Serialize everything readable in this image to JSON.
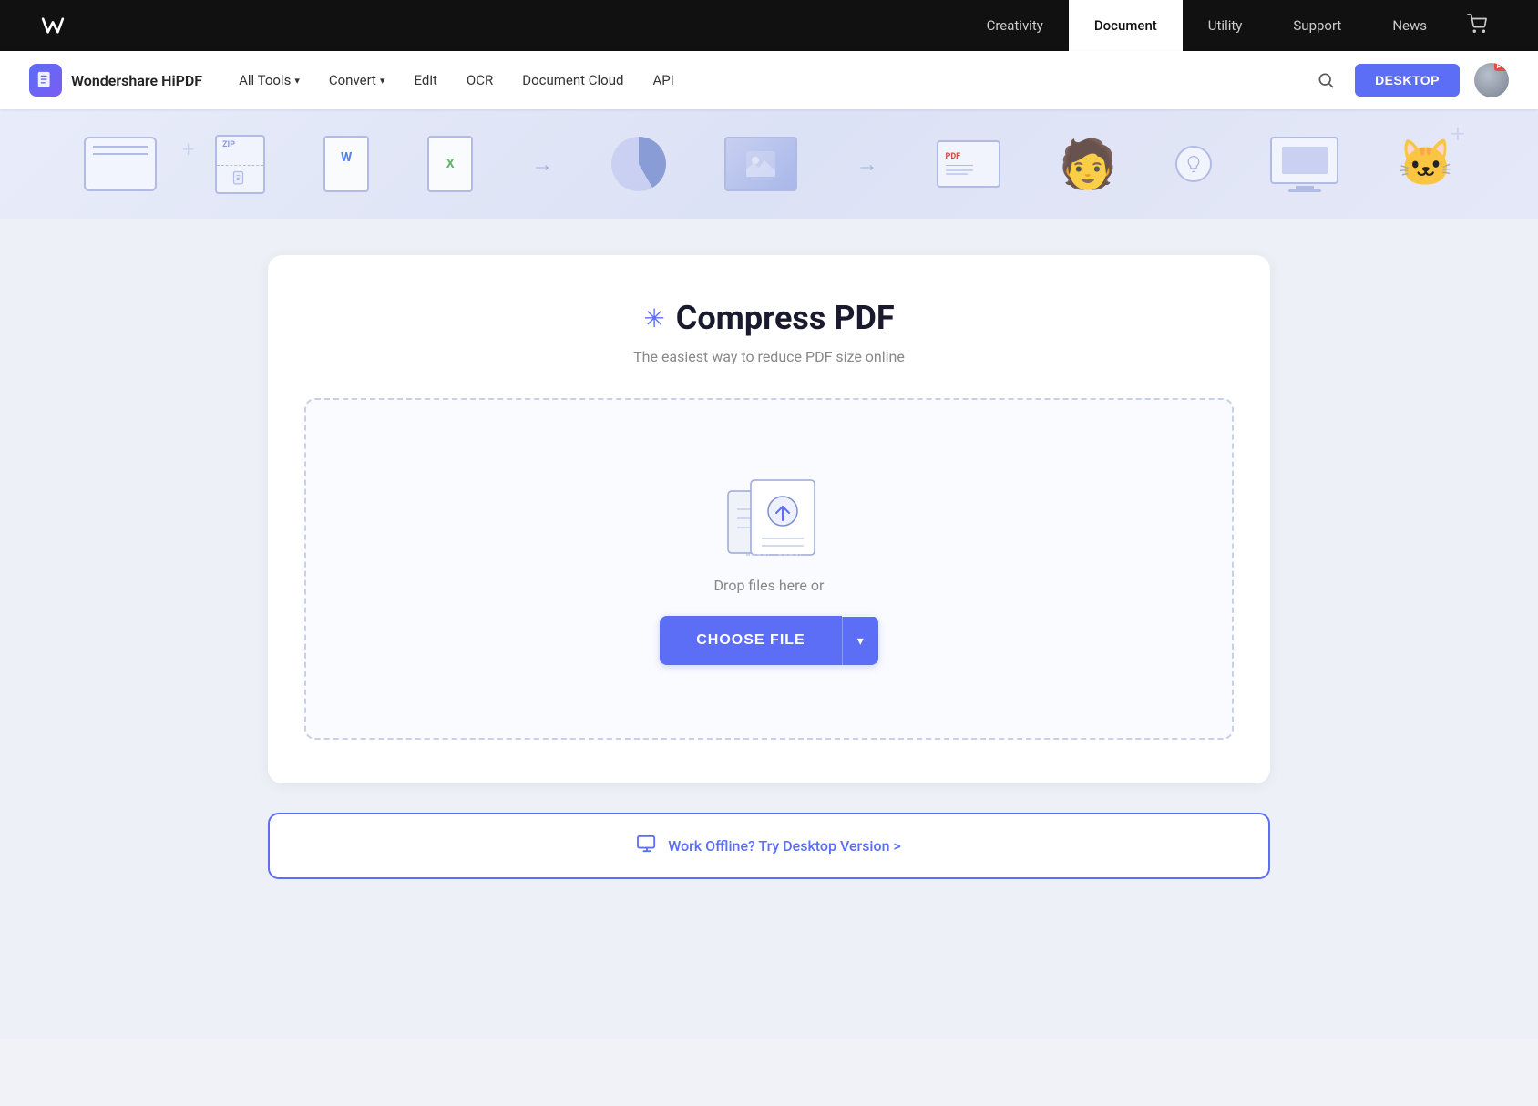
{
  "topNav": {
    "logo": "W",
    "brand": "wondershare",
    "links": [
      {
        "id": "creativity",
        "label": "Creativity",
        "active": false
      },
      {
        "id": "document",
        "label": "Document",
        "active": true
      },
      {
        "id": "utility",
        "label": "Utility",
        "active": false
      },
      {
        "id": "support",
        "label": "Support",
        "active": false
      },
      {
        "id": "news",
        "label": "News",
        "active": false
      }
    ],
    "cart_icon": "🛒"
  },
  "secNav": {
    "brand": "Wondershare HiPDF",
    "items": [
      {
        "id": "all-tools",
        "label": "All Tools",
        "hasDropdown": true
      },
      {
        "id": "convert",
        "label": "Convert",
        "hasDropdown": true
      },
      {
        "id": "edit",
        "label": "Edit",
        "hasDropdown": false
      },
      {
        "id": "ocr",
        "label": "OCR",
        "hasDropdown": false
      },
      {
        "id": "document-cloud",
        "label": "Document Cloud",
        "hasDropdown": false
      },
      {
        "id": "api",
        "label": "API",
        "hasDropdown": false
      }
    ],
    "desktop_btn": "DESKTOP",
    "pro_badge": "Pro"
  },
  "heroBanner": {
    "decorations": [
      "window",
      "zip",
      "doc-word",
      "doc-excel",
      "pie-chart",
      "photo",
      "pdf-box",
      "figure",
      "bulb",
      "monitor",
      "cat"
    ]
  },
  "compressSection": {
    "icon": "✳",
    "title": "Compress PDF",
    "subtitle": "The easiest way to reduce PDF size online",
    "dropzone": {
      "drop_text": "Drop files here or",
      "choose_file_label": "CHOOSE FILE",
      "dropdown_arrow": "▾"
    },
    "offline_banner": {
      "icon": "🖥",
      "text": "Work Offline? Try Desktop Version >"
    }
  }
}
